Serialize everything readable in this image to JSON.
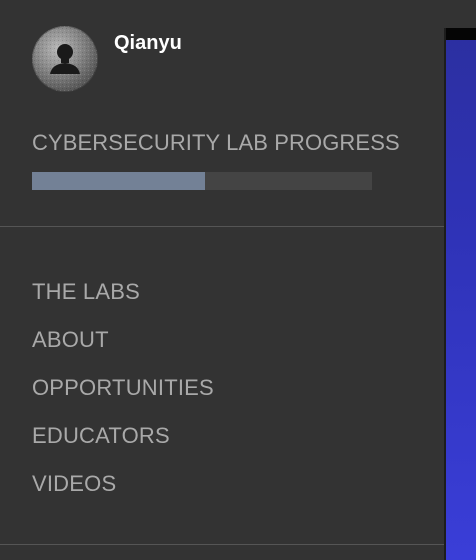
{
  "profile": {
    "username": "Qianyu",
    "avatar_icon": "user-silhouette-icon"
  },
  "progress": {
    "title": "CYBERSECURITY LAB PROGRESS",
    "fraction": 0.51,
    "fill_color": "#738196",
    "track_color": "#444444"
  },
  "nav": {
    "items": [
      {
        "label": "THE LABS"
      },
      {
        "label": "ABOUT"
      },
      {
        "label": "OPPORTUNITIES"
      },
      {
        "label": "EDUCATORS"
      },
      {
        "label": "VIDEOS"
      }
    ]
  },
  "colors": {
    "sidebar_bg": "#333333",
    "text_muted": "#a9a9a9",
    "content_accent": "#3a3ed8"
  }
}
